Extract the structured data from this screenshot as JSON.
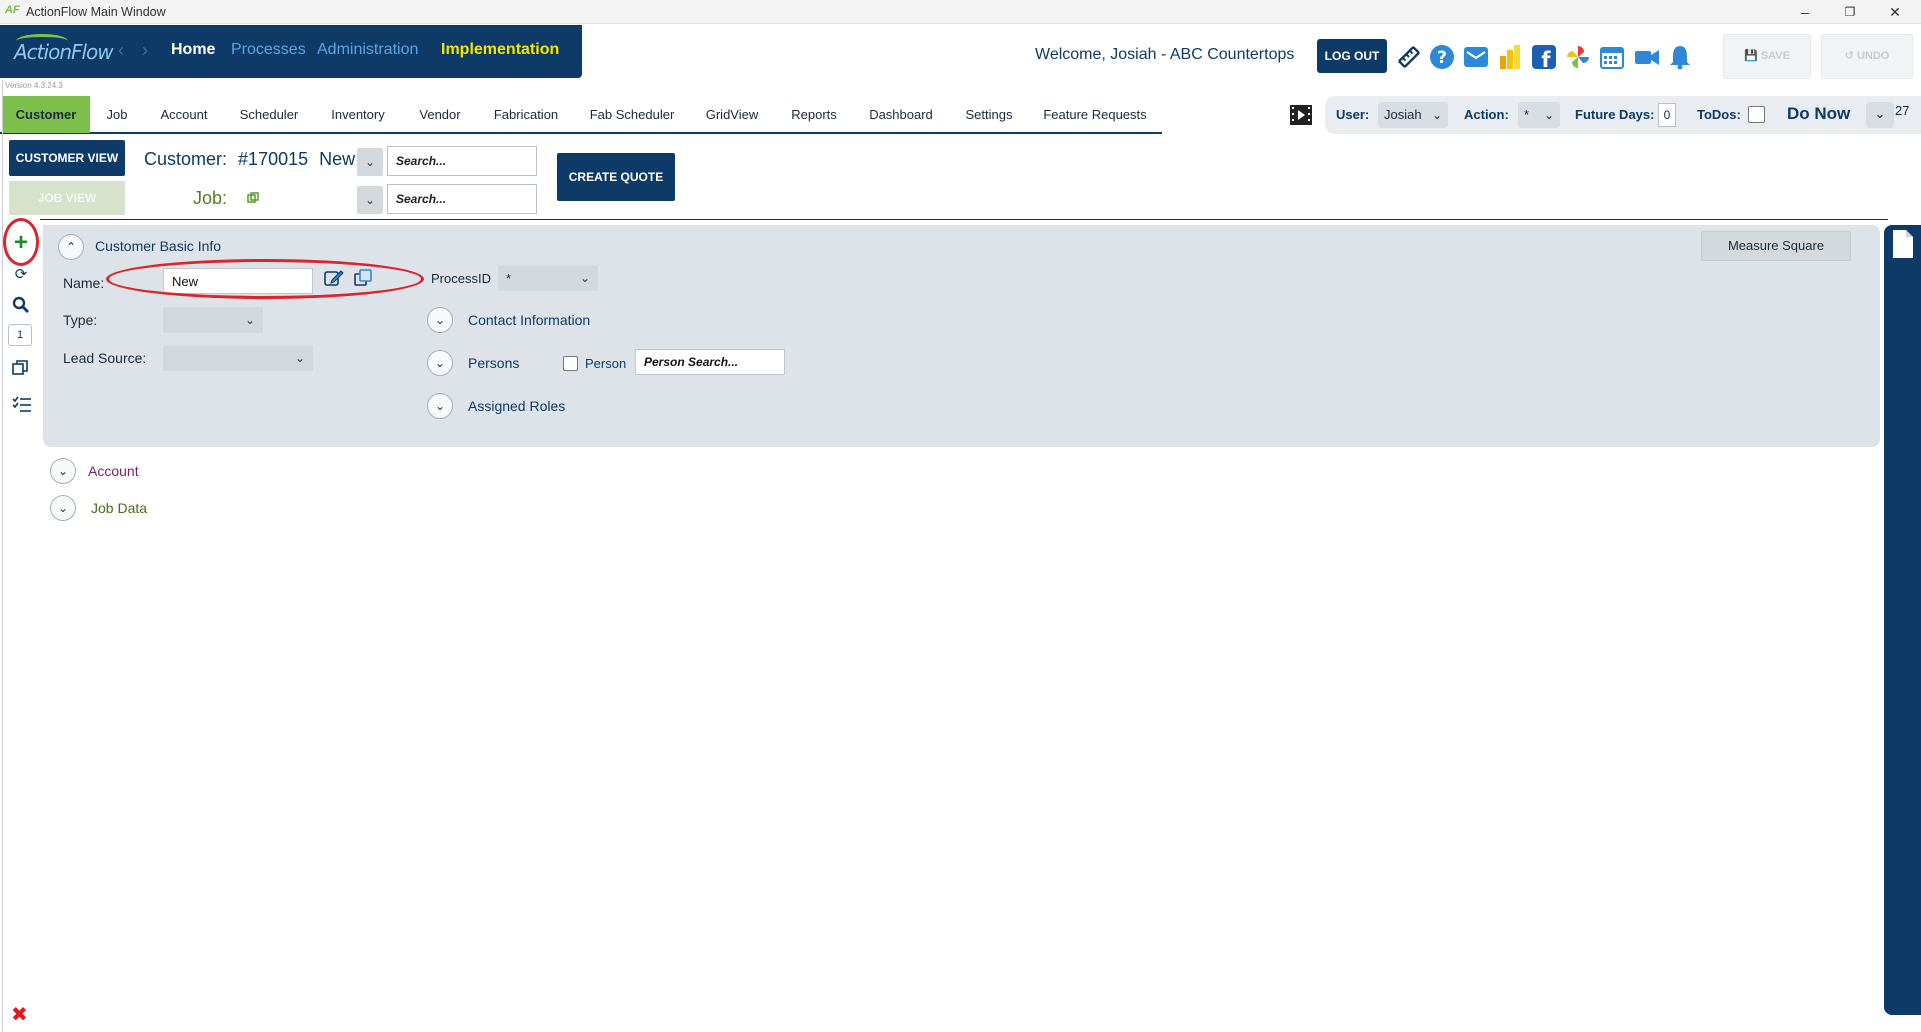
{
  "window": {
    "title": "ActionFlow Main Window",
    "app_icon": "AF"
  },
  "nav": {
    "logo_text": "ActionFlow",
    "links": [
      {
        "label": "Home",
        "color": "#ffffff"
      },
      {
        "label": "Processes",
        "color": "#5aa7e0"
      },
      {
        "label": "Administration",
        "color": "#5aa7e0"
      },
      {
        "label": "Implementation",
        "color": "#f5e600"
      }
    ],
    "version": "Version 4.3.24.3"
  },
  "header": {
    "welcome": "Welcome, Josiah - ABC Countertops",
    "logout_label": "LOG OUT",
    "save_label": "SAVE",
    "undo_label": "UNDO"
  },
  "tabs": [
    "Customer",
    "Job",
    "Account",
    "Scheduler",
    "Inventory",
    "Vendor",
    "Fabrication",
    "Fab Scheduler",
    "GridView",
    "Reports",
    "Dashboard",
    "Settings",
    "Feature Requests"
  ],
  "filters": {
    "user_label": "User:",
    "user_value": "Josiah",
    "action_label": "Action:",
    "action_value": "*",
    "future_days_label": "Future Days:",
    "future_days_value": "0",
    "todos_label": "ToDos:",
    "do_now_label": "Do Now",
    "count": "27"
  },
  "toolbar": {
    "customer_view_label": "CUSTOMER VIEW",
    "job_view_label": "JOB VIEW",
    "customer_label": "Customer:",
    "customer_number": "#170015",
    "customer_name": "New",
    "job_label": "Job:",
    "search_placeholder": "Search...",
    "create_quote_label": "CREATE QUOTE"
  },
  "sidebar": {
    "page_number": "1"
  },
  "basic_info": {
    "title": "Customer Basic Info",
    "name_label": "Name:",
    "name_value": "New",
    "type_label": "Type:",
    "lead_source_label": "Lead Source:",
    "process_id_label": "ProcessID",
    "process_id_value": "*",
    "contact_info_label": "Contact Information",
    "persons_label": "Persons",
    "person_checkbox_label": "Person",
    "person_search_placeholder": "Person Search...",
    "assigned_roles_label": "Assigned Roles",
    "measure_square_label": "Measure Square"
  },
  "sections": {
    "account_label": "Account",
    "job_data_label": "Job Data"
  },
  "colors": {
    "brand_navy": "#0d3a66",
    "active_tab": "#7cc04b",
    "annotation_red": "#d7262c"
  }
}
